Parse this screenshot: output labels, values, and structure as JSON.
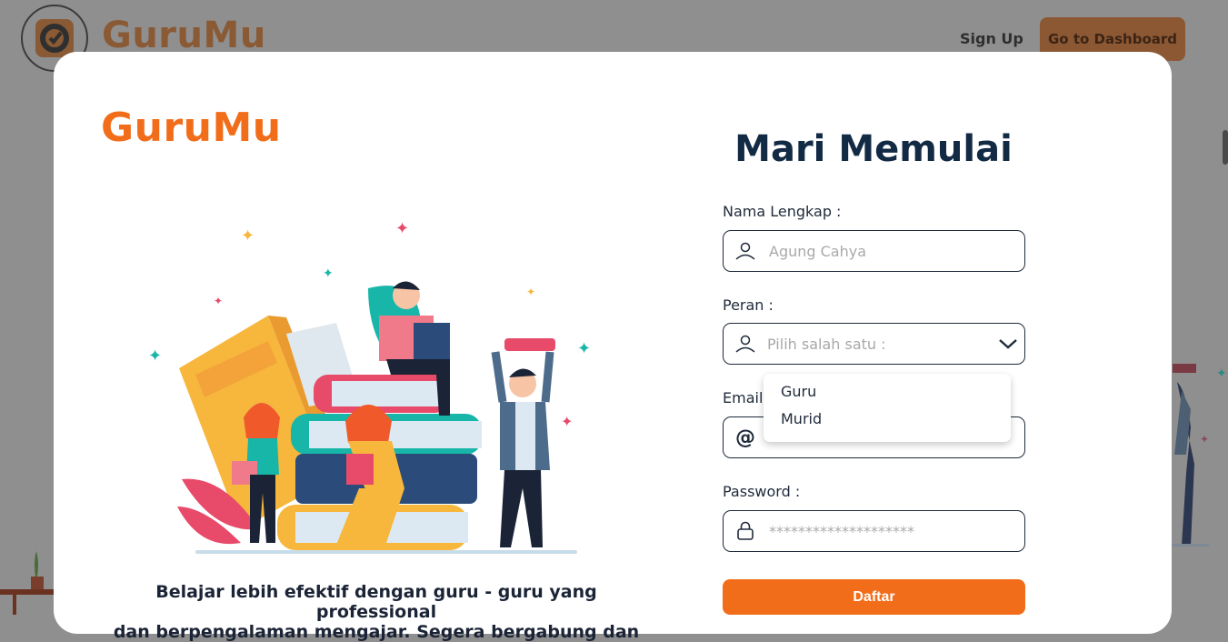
{
  "background": {
    "logo_text": "GuruMu",
    "signup_label": "Sign Up",
    "dashboard_label": "Go to Dashboard"
  },
  "modal": {
    "brand": "GuruMu",
    "tagline_line1": "Belajar lebih efektif dengan guru - guru yang professional",
    "tagline_line2": "dan berpengalaman mengajar. Segera bergabung dan",
    "form": {
      "title": "Mari Memulai",
      "name_label": "Nama Lengkap :",
      "name_placeholder": "Agung Cahya",
      "role_label": "Peran :",
      "role_placeholder": "Pilih salah satu :",
      "role_options": [
        "Guru",
        "Murid"
      ],
      "email_label": "Email",
      "password_label": "Password :",
      "password_placeholder": "********************",
      "submit_label": "Daftar"
    }
  },
  "icons": {
    "name": "user-icon",
    "role": "user-icon",
    "email": "at-icon",
    "password": "lock-icon",
    "select": "chevron-down-icon"
  },
  "colors": {
    "accent": "#f26d1a",
    "title": "#132a45",
    "overlay": "#8f8f8f"
  }
}
